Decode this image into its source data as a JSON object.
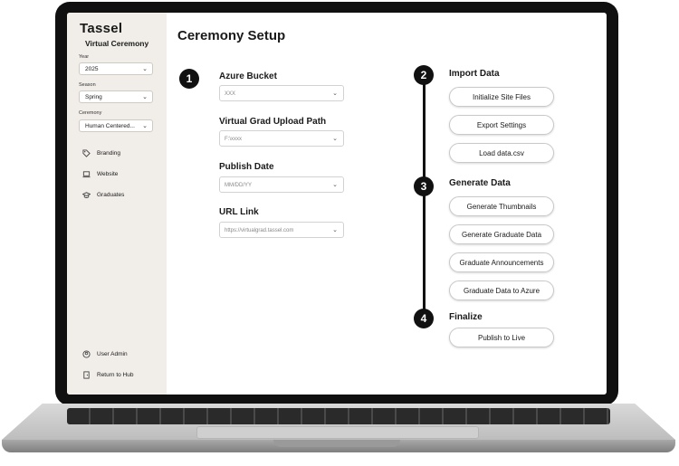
{
  "sidebar": {
    "logo": "Tassel",
    "subtitle": "Virtual Ceremony",
    "filters": [
      {
        "label": "Year",
        "value": "2025"
      },
      {
        "label": "Season",
        "value": "Spring"
      },
      {
        "label": "Ceremony",
        "value": "Human Centered..."
      }
    ],
    "nav": [
      {
        "label": "Branding",
        "icon": "tag-icon"
      },
      {
        "label": "Website",
        "icon": "laptop-icon"
      },
      {
        "label": "Graduates",
        "icon": "graduation-cap-icon"
      }
    ],
    "bottom": [
      {
        "label": "User Admin",
        "icon": "user-admin-icon"
      },
      {
        "label": "Return to Hub",
        "icon": "door-exit-icon"
      }
    ]
  },
  "main": {
    "title": "Ceremony Setup",
    "step1": "1",
    "fields": [
      {
        "label": "Azure Bucket",
        "value": "XXX"
      },
      {
        "label": "Virtual Grad Upload Path",
        "value": "F:\\xxxx"
      },
      {
        "label": "Publish Date",
        "value": "MM/DD/YY"
      },
      {
        "label": "URL Link",
        "value": "https://virtualgrad.tassel.com"
      }
    ],
    "sections": [
      {
        "step": "2",
        "title": "Import Data",
        "buttons": [
          "Initialize Site Files",
          "Export Settings",
          "Load data.csv"
        ]
      },
      {
        "step": "3",
        "title": "Generate Data",
        "buttons": [
          "Generate Thumbnails",
          "Generate Graduate Data",
          "Graduate Announcements",
          "Graduate Data to Azure"
        ]
      },
      {
        "step": "4",
        "title": "Finalize",
        "buttons": [
          "Publish to Live"
        ]
      }
    ]
  }
}
